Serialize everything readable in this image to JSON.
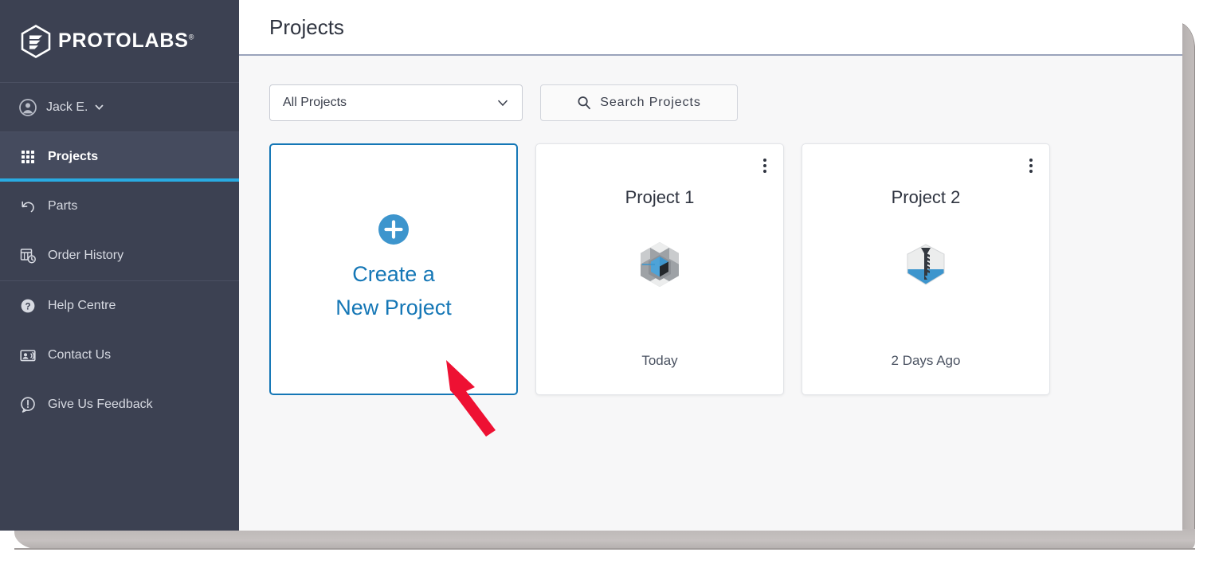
{
  "brand": {
    "name": "PROTOLABS",
    "logo_icon": "protolabs-hexagon-logo",
    "trademark": "®"
  },
  "colors": {
    "sidebar_bg": "#3c4152",
    "sidebar_active_bg": "#454b5e",
    "accent_cyan": "#29abe2",
    "link_blue": "#1577b6",
    "content_bg": "#f7f7f8",
    "annotation_red": "#ee1133",
    "header_divider": "#9aa3bb"
  },
  "sidebar": {
    "user": {
      "name": "Jack E.",
      "avatar_icon": "user-circle-icon",
      "caret_icon": "chevron-down-icon"
    },
    "items": [
      {
        "label": "Projects",
        "icon": "grid-apps-icon",
        "active": true
      },
      {
        "label": "Parts",
        "icon": "undo-arrow-icon",
        "active": false
      },
      {
        "label": "Order History",
        "icon": "order-history-clock-icon",
        "active": false
      },
      {
        "label": "Help Centre",
        "icon": "question-mark-circle-icon",
        "active": false
      },
      {
        "label": "Contact Us",
        "icon": "contact-card-icon",
        "active": false
      },
      {
        "label": "Give Us Feedback",
        "icon": "feedback-exclamation-icon",
        "active": false
      }
    ]
  },
  "header": {
    "title": "Projects"
  },
  "controls": {
    "filter_select": {
      "value": "All Projects",
      "caret_icon": "chevron-down-icon",
      "options": [
        "All Projects"
      ]
    },
    "search": {
      "label": "Search Projects",
      "icon": "search-icon"
    }
  },
  "create_card": {
    "icon": "plus-circle-icon",
    "line1": "Create a",
    "line2": "New Project"
  },
  "projects": [
    {
      "name": "Project 1",
      "date": "Today",
      "thumb_icon": "hexagon-blue-cube-icon",
      "menu_icon": "kebab-menu-icon"
    },
    {
      "name": "Project 2",
      "date": "2 Days Ago",
      "thumb_icon": "hexagon-screw-icon",
      "menu_icon": "kebab-menu-icon"
    }
  ],
  "annotation": {
    "arrow_icon": "red-pointer-arrow",
    "points_to": "create-new-project-card"
  }
}
